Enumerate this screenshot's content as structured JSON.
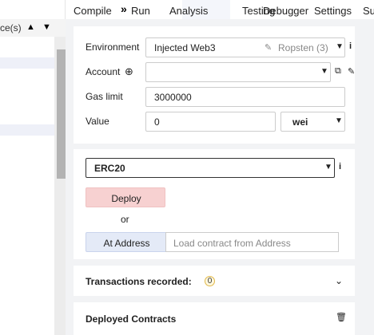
{
  "left_panel": {
    "header_text": "ce(s)",
    "up_icon": "chevron-up",
    "down_icon": "chevron-down"
  },
  "tabs": {
    "overflow_icon": "double-chevron-right",
    "items": [
      "Compile",
      "Run",
      "Analysis",
      "Testing",
      "Debugger",
      "Settings",
      "Su"
    ],
    "active": "Run"
  },
  "environment": {
    "label": "Environment",
    "value": "Injected Web3",
    "network": "Ropsten (3)",
    "network_icon": "plug-icon"
  },
  "account": {
    "label": "Account",
    "value": ""
  },
  "gas_limit": {
    "label": "Gas limit",
    "value": "3000000"
  },
  "value": {
    "label": "Value",
    "amount": "0",
    "unit": "wei"
  },
  "contract": {
    "selected": "ERC20",
    "deploy_label": "Deploy",
    "or_label": "or",
    "at_address_label": "At Address",
    "address_placeholder": "Load contract from Address"
  },
  "transactions": {
    "label": "Transactions recorded:",
    "count": "0"
  },
  "deployed": {
    "label": "Deployed Contracts"
  },
  "colors": {
    "deploy_bg": "#f7d1d1",
    "at_address_bg": "#e4eaf7",
    "panel_bg": "#f2f3f5"
  }
}
